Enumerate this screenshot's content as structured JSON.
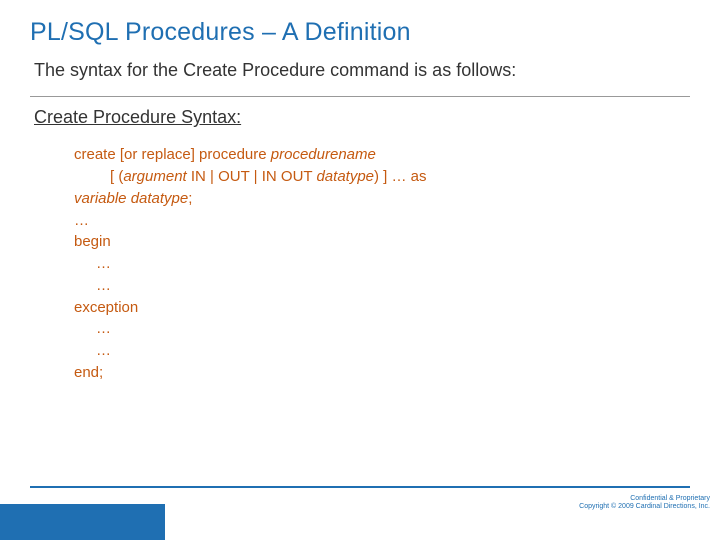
{
  "title": "PL/SQL Procedures – A Definition",
  "intro": "The syntax for the Create Procedure command is as follows:",
  "subhead": "Create Procedure Syntax:",
  "code": {
    "l1a": "create [or replace] procedure ",
    "l1b": "procedurename",
    "l2a": "[ (",
    "l2b": "argument",
    "l2c": " IN | OUT | IN OUT ",
    "l2d": "datatype",
    "l2e": ") ] … as",
    "l3a": "variable datatype",
    "l3b": ";",
    "l4": "…",
    "l5": "begin",
    "l6": "…",
    "l7": "…",
    "l8": "exception",
    "l9": "…",
    "l10": "…",
    "l11": "end;"
  },
  "footer": {
    "line1": "Confidential & Proprietary",
    "line2": "Copyright © 2009 Cardinal Directions, Inc."
  }
}
